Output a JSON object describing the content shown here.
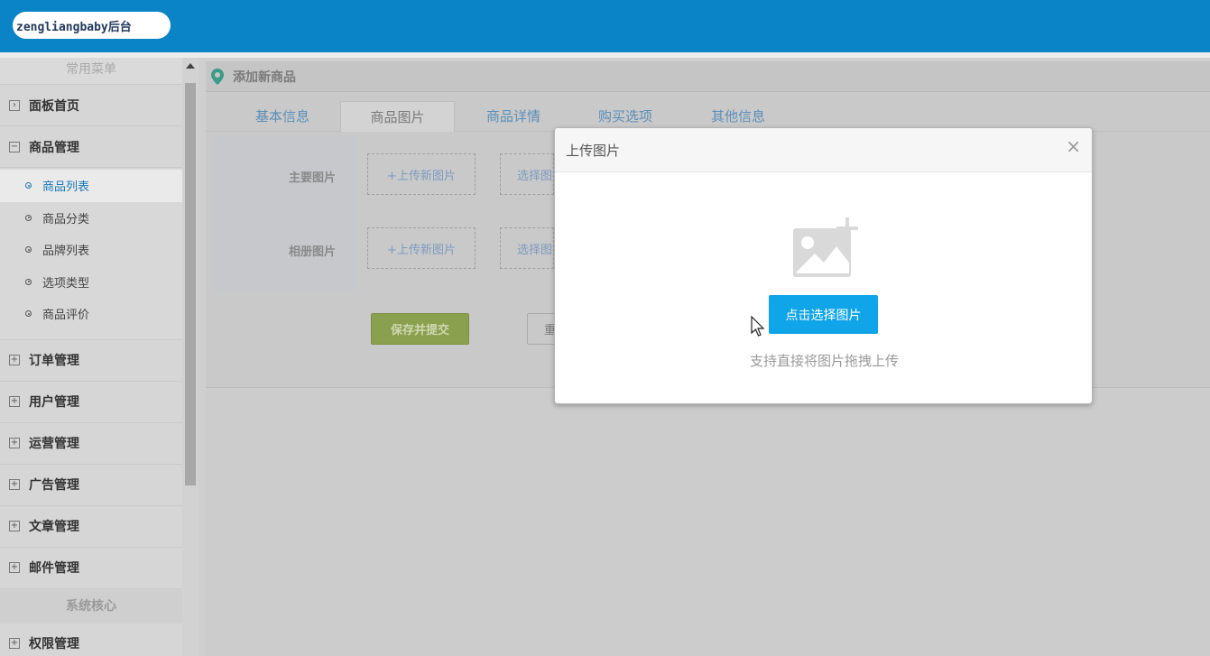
{
  "header": {
    "brand": "zengliangbaby后台",
    "bg_color": "#0a84c6"
  },
  "sidebar": {
    "title": "常用菜单",
    "items_top": [
      {
        "label": "面板首页",
        "icon": "expand-box-icon",
        "expanded": false
      },
      {
        "label": "商品管理",
        "icon": "collapse-box-icon",
        "expanded": true
      }
    ],
    "sub_items": [
      {
        "label": "商品列表",
        "active": true
      },
      {
        "label": "商品分类",
        "active": false
      },
      {
        "label": "品牌列表",
        "active": false
      },
      {
        "label": "选项类型",
        "active": false
      },
      {
        "label": "商品评价",
        "active": false
      }
    ],
    "items_bottom": [
      {
        "label": "订单管理"
      },
      {
        "label": "用户管理"
      },
      {
        "label": "运营管理"
      },
      {
        "label": "广告管理"
      },
      {
        "label": "文章管理"
      },
      {
        "label": "邮件管理"
      }
    ],
    "section2_title": "系统核心",
    "items_section2": [
      {
        "label": "权限管理"
      }
    ]
  },
  "main": {
    "breadcrumb": "添加新商品",
    "tabs": [
      {
        "label": "基本信息",
        "active": false
      },
      {
        "label": "商品图片",
        "active": true
      },
      {
        "label": "商品详情",
        "active": false
      },
      {
        "label": "购买选项",
        "active": false
      },
      {
        "label": "其他信息",
        "active": false
      }
    ],
    "rows": [
      {
        "label": "主要图片",
        "upload": "+上传新图片",
        "select": "选择图"
      },
      {
        "label": "相册图片",
        "upload": "+上传新图片",
        "select": "选择图"
      }
    ],
    "save_label": "保存并提交",
    "reset_label": "重"
  },
  "modal": {
    "title": "上传图片",
    "close": "×",
    "choose_label": "点击选择图片",
    "hint": "支持直接将图片拖拽上传",
    "accent": "#0fa5e8"
  }
}
